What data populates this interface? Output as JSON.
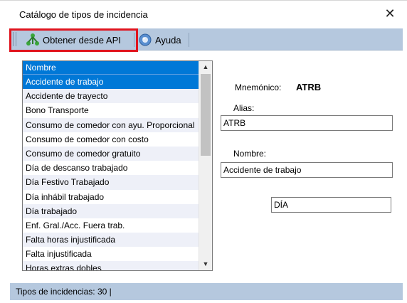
{
  "window": {
    "title": "Catálogo de tipos de incidencia",
    "close_glyph": "✕"
  },
  "toolbar": {
    "api_label": "Obtener desde API",
    "api_icon": "network-tree-icon",
    "help_label": "Ayuda",
    "help_icon": "help-globe-icon"
  },
  "list": {
    "header": "Nombre",
    "selected_index": 0,
    "items": [
      "Accidente de trabajo",
      "Accidente de trayecto",
      "Bono Transporte",
      "Consumo de comedor con ayu. Proporcional",
      "Consumo de comedor con costo",
      "Consumo de comedor gratuito",
      "Día de descanso trabajado",
      "Día Festivo Trabajado",
      "Día inhábil trabajado",
      "Día trabajado",
      "Enf. Gral./Acc. Fuera trab.",
      "Falta horas injustificada",
      "Falta injustificada",
      "Horas extras dobles"
    ]
  },
  "details": {
    "mnemonic_label": "Mnemónico:",
    "mnemonic_value": "ATRB",
    "alias_label": "Alias:",
    "alias_value": "ATRB",
    "name_label": "Nombre:",
    "name_value": "Accidente de trabajo",
    "unit_value": "DÍA"
  },
  "status": {
    "text": "Tipos de incidencias:  30  |"
  },
  "colors": {
    "selection": "#0078d7",
    "toolbar_bg": "#b5c8de",
    "highlight": "#e0141e"
  }
}
